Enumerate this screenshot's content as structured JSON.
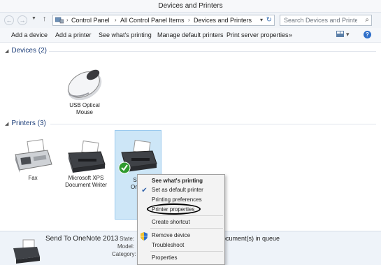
{
  "window": {
    "title": "Devices and Printers"
  },
  "address": {
    "breadcrumb": [
      "Control Panel",
      "All Control Panel Items",
      "Devices and Printers"
    ],
    "separator": "›",
    "back_icon": "back-arrow-icon",
    "forward_icon": "forward-arrow-icon",
    "up_icon": "up-arrow-icon"
  },
  "search": {
    "placeholder": "Search Devices and Printers"
  },
  "toolbar": {
    "items": [
      "Add a device",
      "Add a printer",
      "See what's printing",
      "Manage default printers",
      "Print server properties"
    ],
    "more": "»"
  },
  "groups": {
    "devices": {
      "label": "Devices (2)"
    },
    "printers": {
      "label": "Printers (3)"
    }
  },
  "devices": [
    {
      "label_line1": "USB Optical",
      "label_line2": "Mouse",
      "icon": "mouse-icon"
    }
  ],
  "printers": [
    {
      "label_line1": "Fax",
      "label_line2": "",
      "icon": "fax-icon"
    },
    {
      "label_line1": "Microsoft XPS",
      "label_line2": "Document Writer",
      "icon": "printer-icon"
    },
    {
      "label_line1": "Sen",
      "label_line2": "OneN",
      "icon": "printer-default-icon",
      "selected": true
    }
  ],
  "context_menu": {
    "items": [
      {
        "label": "See what's printing",
        "bold": true
      },
      {
        "label": "Set as default printer",
        "checked": true
      },
      {
        "label": "Printing preferences"
      },
      {
        "label": "Printer properties",
        "circled": true
      },
      {
        "label": "Create shortcut"
      },
      {
        "label": "Remove device",
        "icon": "shield-icon"
      },
      {
        "label": "Troubleshoot"
      },
      {
        "label": "Properties"
      }
    ]
  },
  "details": {
    "name": "Send To OneNote 2013",
    "labels": [
      "State:",
      "Model:",
      "Category:"
    ],
    "queue": "ocument(s) in queue"
  },
  "colors": {
    "selection": "#cde6f7",
    "header_text": "#1e3f7a",
    "accent": "#2f6fc9"
  }
}
